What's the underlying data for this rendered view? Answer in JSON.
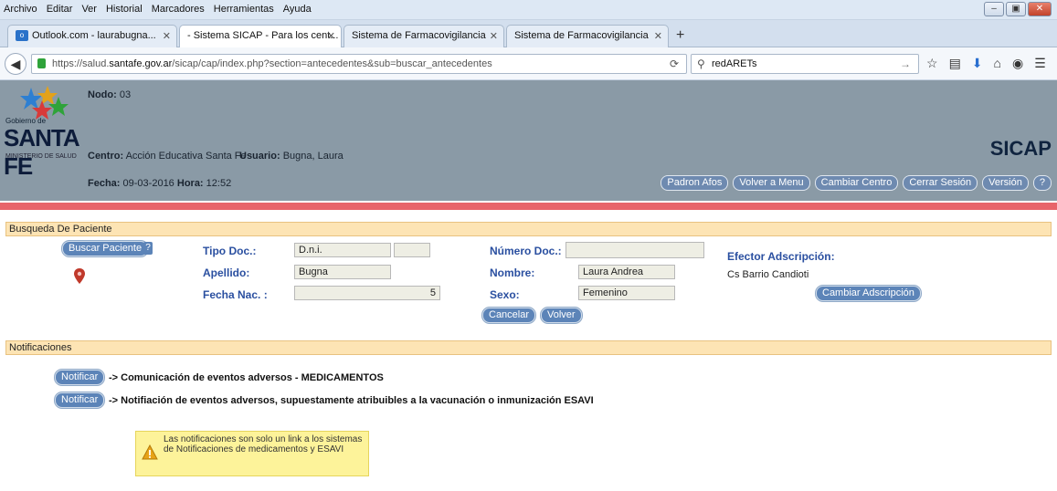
{
  "menubar": {
    "items": [
      "Archivo",
      "Editar",
      "Ver",
      "Historial",
      "Marcadores",
      "Herramientas",
      "Ayuda"
    ]
  },
  "tabs": [
    {
      "label": "Outlook.com - laurabugna...",
      "active": false
    },
    {
      "label": "- Sistema SICAP - Para los cent...",
      "active": true
    },
    {
      "label": "Sistema de Farmacovigilancia",
      "active": false
    },
    {
      "label": "Sistema de Farmacovigilancia",
      "active": false
    }
  ],
  "navbar": {
    "url_prefix": "https://salud.",
    "url_domain": "santafe.gov.ar",
    "url_suffix": "/sicap/cap/index.php?section=antecedentes&sub=buscar_antecedentes",
    "search_text": "redARETs"
  },
  "header": {
    "logo_gobierno": "Gobierno de",
    "logo_santafe": "SANTA FE",
    "logo_ministerio": "MINISTERIO DE SALUD",
    "nodo_label": "Nodo:",
    "nodo_value": "03",
    "centro_label": "Centro:",
    "centro_value": "Acción Educativa Santa Fe",
    "usuario_label": "Usuario:",
    "usuario_value": "Bugna, Laura",
    "fecha_label": "Fecha:",
    "fecha_value": "09-03-2016",
    "hora_label": "Hora:",
    "hora_value": "12:52",
    "app_title": "SICAP",
    "buttons": [
      "Padron Afos",
      "Volver a Menu",
      "Cambiar Centro",
      "Cerrar Sesión",
      "Versión",
      "?"
    ]
  },
  "busqueda": {
    "section_title": "Busqueda De Paciente",
    "buscar_button": "Buscar Paciente",
    "help": "?",
    "tipo_doc_label": "Tipo Doc.:",
    "tipo_doc_value": "D.n.i.",
    "tipo_doc_extra": "",
    "numero_doc_label": "Número Doc.:",
    "numero_doc_value": "",
    "apellido_label": "Apellido:",
    "apellido_value": "Bugna",
    "nombre_label": "Nombre:",
    "nombre_value": "Laura Andrea",
    "fecha_nac_label": "Fecha Nac. :",
    "fecha_nac_value": "",
    "fecha_nac_suffix": "5",
    "sexo_label": "Sexo:",
    "sexo_value": "Femenino",
    "efector_label": "Efector Adscripción:",
    "efector_value": "Cs Barrio Candioti",
    "cambiar_adscripcion": "Cambiar Adscripción",
    "cancelar": "Cancelar",
    "volver": "Volver"
  },
  "notificaciones": {
    "section_title": "Notificaciones",
    "button_label": "Notificar",
    "item1": "-> Comunicación de eventos adversos - MEDICAMENTOS",
    "item2": "-> Notifiación de eventos adversos, supuestamente atribuibles a la vacunación o inmunización ESAVI",
    "warning": "Las notificaciones son solo un link a los sistemas de Notificaciones de medicamentos y ESAVI"
  },
  "colors": {
    "header_bg": "#8a9aa6",
    "red_bar": "#e8646a",
    "section_bg": "#fde4b4",
    "label_blue": "#2a4fa0",
    "button_blue": "#5c84b8",
    "warning_bg": "#fdf39a"
  }
}
